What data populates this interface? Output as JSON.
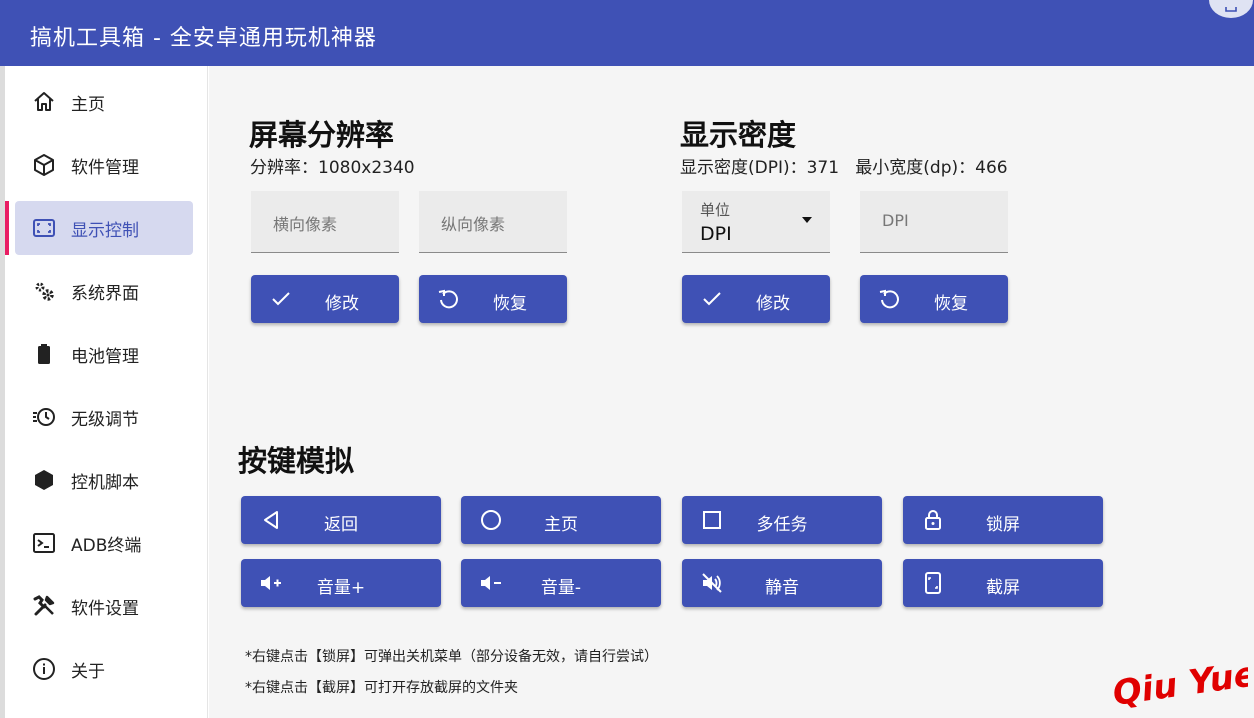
{
  "window": {
    "title": "搞机工具箱 - 全安卓通用玩机神器"
  },
  "sidebar": {
    "items": [
      {
        "label": "主页",
        "icon": "home-icon"
      },
      {
        "label": "软件管理",
        "icon": "package-icon"
      },
      {
        "label": "显示控制",
        "icon": "screen-expand-icon",
        "active": true
      },
      {
        "label": "系统界面",
        "icon": "gears-icon"
      },
      {
        "label": "电池管理",
        "icon": "battery-icon"
      },
      {
        "label": "无级调节",
        "icon": "clock-adjust-icon"
      },
      {
        "label": "控机脚本",
        "icon": "hexagon-icon"
      },
      {
        "label": "ADB终端",
        "icon": "terminal-icon"
      },
      {
        "label": "软件设置",
        "icon": "tools-icon"
      },
      {
        "label": "关于",
        "icon": "info-icon"
      }
    ]
  },
  "resolution": {
    "title": "屏幕分辨率",
    "info": "分辨率：1080x2340",
    "width_placeholder": "横向像素",
    "height_placeholder": "纵向像素",
    "modify_label": "修改",
    "restore_label": "恢复"
  },
  "density": {
    "title": "显示密度",
    "info": "显示密度(DPI)：371   最小宽度(dp)：466",
    "unit_caption": "单位",
    "unit_value": "DPI",
    "dpi_placeholder": "DPI",
    "modify_label": "修改",
    "restore_label": "恢复"
  },
  "keys": {
    "title": "按键模拟",
    "buttons": [
      {
        "label": "返回",
        "icon": "back-triangle-icon"
      },
      {
        "label": "主页",
        "icon": "home-circle-icon"
      },
      {
        "label": "多任务",
        "icon": "square-icon"
      },
      {
        "label": "锁屏",
        "icon": "lock-icon"
      },
      {
        "label": "音量+",
        "icon": "volume-up-icon"
      },
      {
        "label": "音量-",
        "icon": "volume-down-icon"
      },
      {
        "label": "静音",
        "icon": "mute-icon"
      },
      {
        "label": "截屏",
        "icon": "screenshot-icon"
      }
    ],
    "notes": [
      "*右键点击【锁屏】可弹出关机菜单（部分设备无效，请自行尝试）",
      "*右键点击【截屏】可打开存放截屏的文件夹"
    ]
  },
  "watermark": {
    "text": "Qiu Yue"
  },
  "colors": {
    "primary": "#3f51b5",
    "active_bg": "#d6d9ef",
    "active_bar": "#e91e63",
    "watermark": "#e00000"
  }
}
